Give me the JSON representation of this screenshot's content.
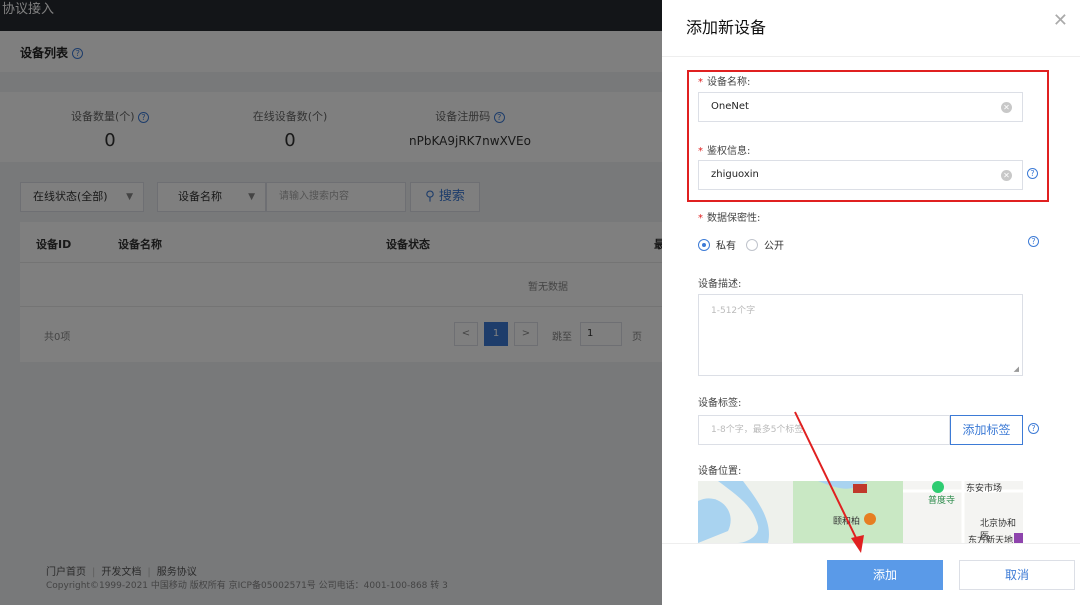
{
  "app": {
    "title": "协议接入"
  },
  "page": {
    "title": "设备列表",
    "help_icon": "question-circle-icon"
  },
  "stats": [
    {
      "label": "设备数量(个)",
      "value": "0",
      "has_help": true
    },
    {
      "label": "在线设备数(个)",
      "value": "0",
      "has_help": false
    },
    {
      "label": "设备注册码",
      "value": "nPbKA9jRK7nwXVEo",
      "has_help": true
    }
  ],
  "filters": {
    "status_select": "在线状态(全部)",
    "field_select": "设备名称",
    "search_placeholder": "请输入搜索内容",
    "search_button": "搜索"
  },
  "table": {
    "columns": [
      "设备ID",
      "设备名称",
      "设备状态",
      "最"
    ],
    "empty_text": "暂无数据",
    "total": "共0项",
    "pagination": {
      "prev": "<",
      "current": "1",
      "next": ">",
      "goto_label": "跳至",
      "goto_value": "1",
      "page_suffix": "页"
    }
  },
  "footer": {
    "links": [
      "门户首页",
      "开发文档",
      "服务协议"
    ],
    "copyright": "Copyright©1999-2021 中国移动 版权所有 京ICP备05002571号 公司电话：4001-100-868 转 3"
  },
  "drawer": {
    "title": "添加新设备",
    "close_icon": "close-icon",
    "fields": {
      "device_name": {
        "label": "设备名称:",
        "value": "OneNet",
        "required": true
      },
      "auth_info": {
        "label": "鉴权信息:",
        "value": "zhiguoxin",
        "required": true
      },
      "privacy": {
        "label": "数据保密性:",
        "required": true,
        "options": [
          "私有",
          "公开"
        ],
        "selected": "私有"
      },
      "description": {
        "label": "设备描述:",
        "placeholder": "1-512个字"
      },
      "tags": {
        "label": "设备标签:",
        "placeholder": "1-8个字，最多5个标签",
        "add_button": "添加标签"
      },
      "location": {
        "label": "设备位置:",
        "map_labels": [
          "东安市场",
          "普度寺",
          "北京协和医",
          "东方新天地",
          "普度寺",
          "颐和柏"
        ]
      }
    },
    "buttons": {
      "add": "添加",
      "cancel": "取消"
    }
  },
  "colors": {
    "accent": "#3d7bd6",
    "primary_button": "#5a9ae8",
    "highlight_box": "#e02020",
    "annotation_arrow": "#e02020",
    "topbar": "#262a30"
  }
}
